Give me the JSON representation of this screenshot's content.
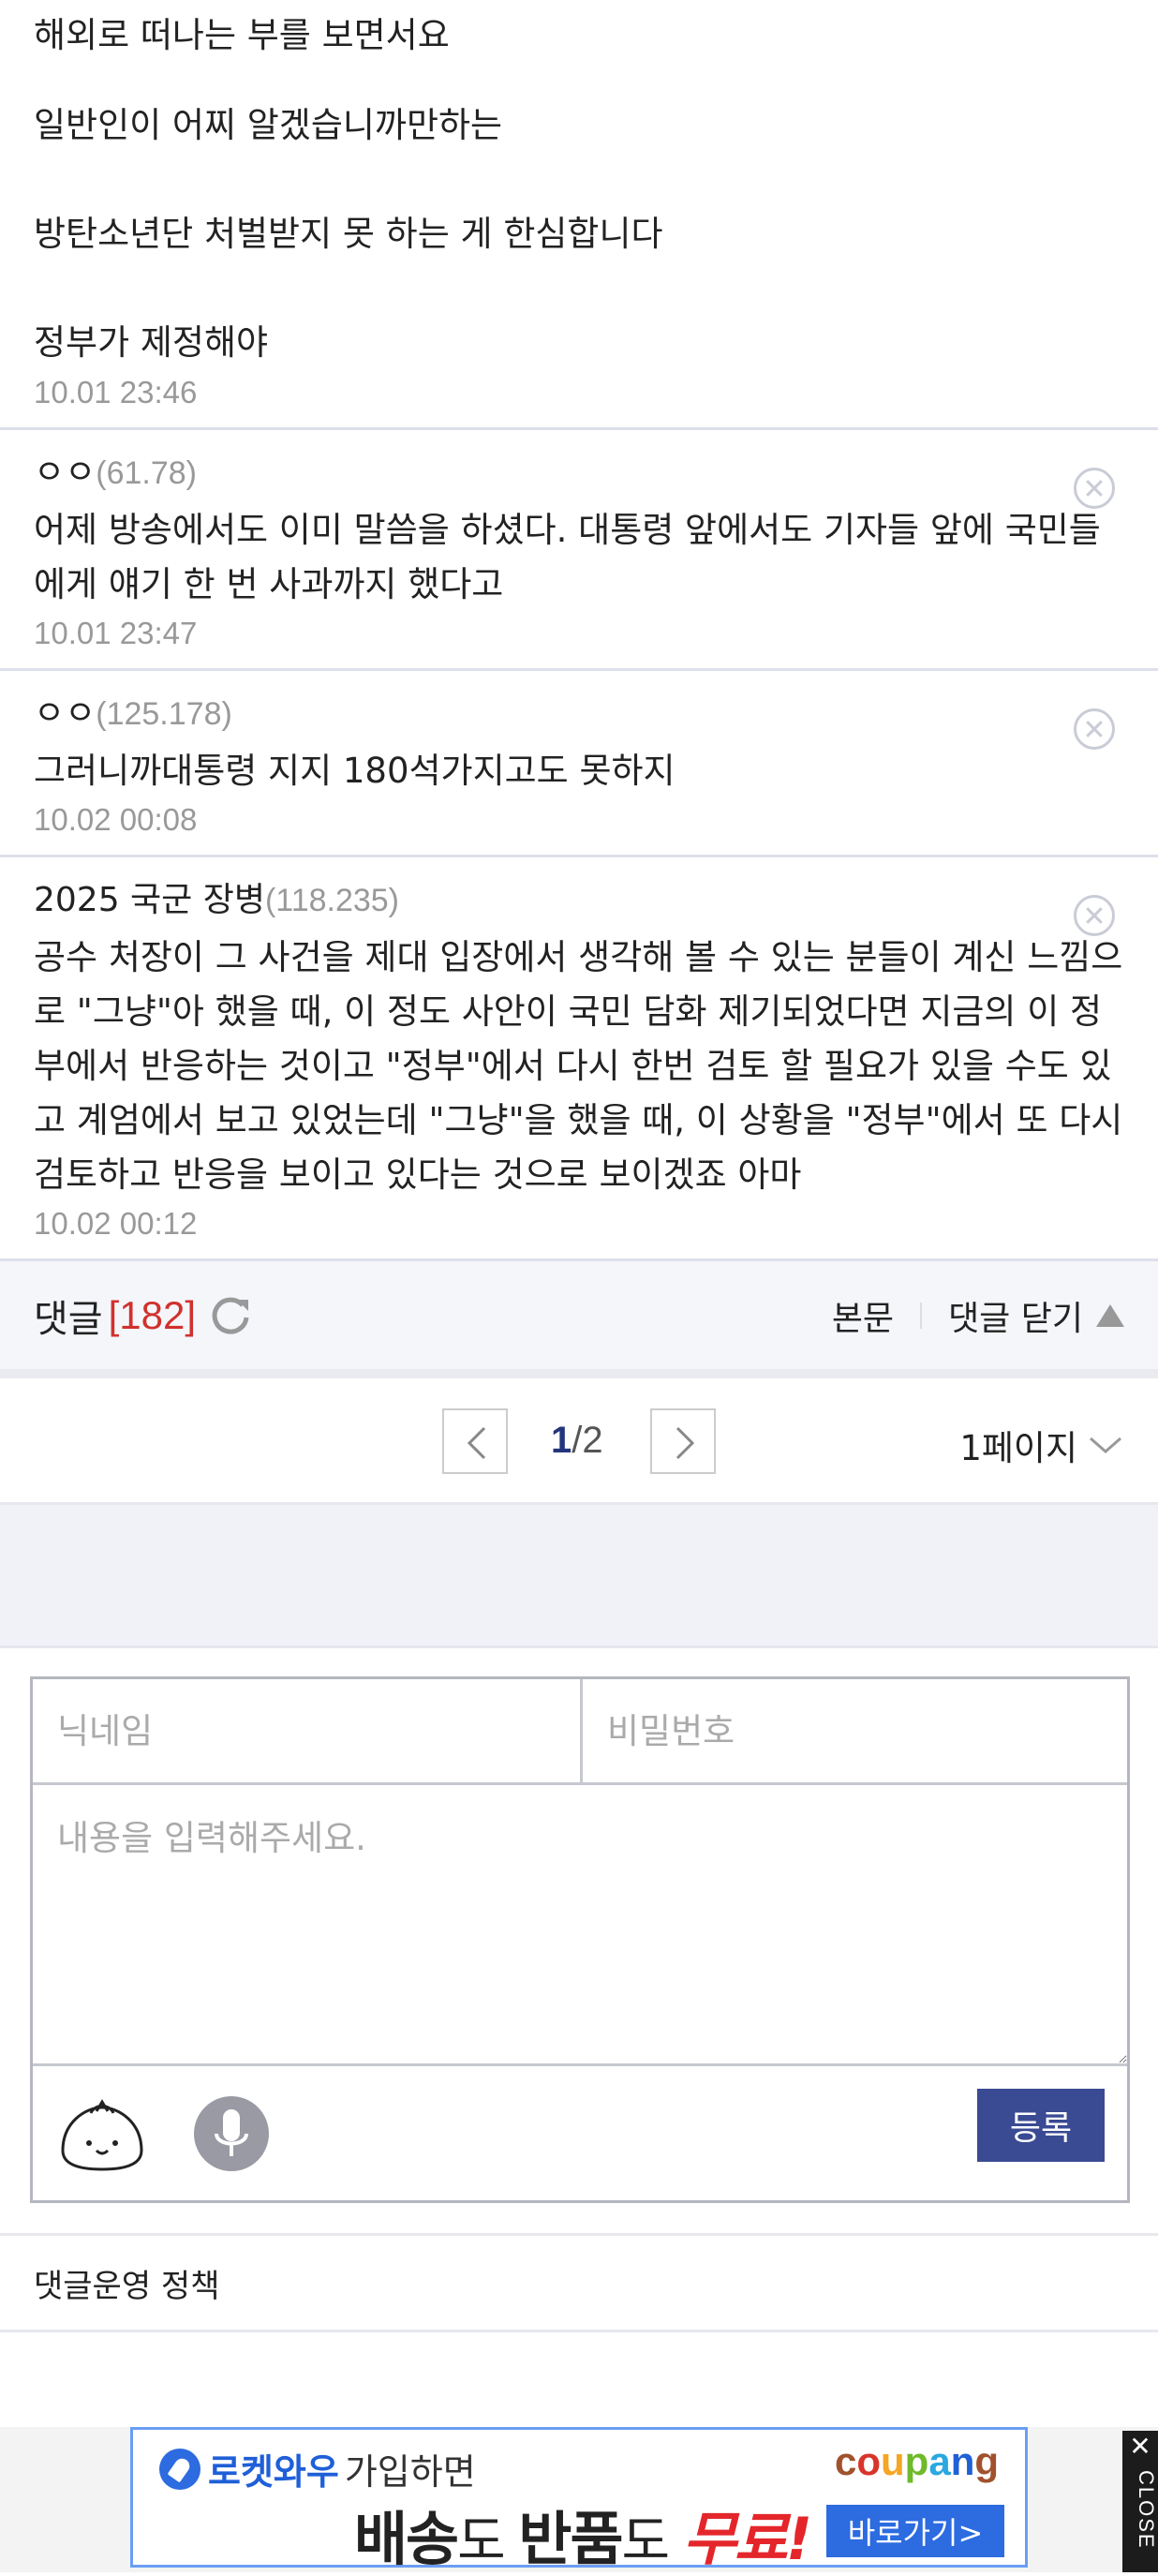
{
  "top_comment": {
    "lines": [
      "해외로 떠나는 부를 보면서요",
      "일반인이 어찌 알겠습니까만하는",
      "방탄소년단 처벌받지 못 하는 게 한심합니다",
      "정부가 제정해야"
    ],
    "date": "10.01 23:46"
  },
  "comments": [
    {
      "name": "ㅇㅇ",
      "ip": "(61.78)",
      "text": "어제 방송에서도 이미 말씀을 하셨다. 대통령 앞에서도 기자들 앞에 국민들에게 얘기 한 번 사과까지 했다고",
      "date": "10.01 23:47"
    },
    {
      "name": "ㅇㅇ",
      "ip": "(125.178)",
      "text": "그러니까대통령 지지 180석가지고도 못하지",
      "date": "10.02 00:08"
    },
    {
      "name": "2025 국군 장병",
      "ip": "(118.235)",
      "text": "공수 처장이 그 사건을 제대 입장에서 생각해 볼 수 있는 분들이 계신 느낌으로 \"그냥\"아 했을 때, 이 정도 사안이 국민 담화 제기되었다면 지금의 이 정부에서 반응하는 것이고 \"정부\"에서 다시 한번 검토 할 필요가 있을 수도 있고 계엄에서 보고 있었는데 \"그냥\"을 했을 때, 이 상황을 \"정부\"에서 또 다시 검토하고 반응을 보이고 있다는 것으로 보이겠죠 아마",
      "date": "10.02 00:12"
    }
  ],
  "comment_bar": {
    "title": "댓글",
    "count": "[182]",
    "sort_label": "본문",
    "collapse_label": "댓글 닫기"
  },
  "pager": {
    "current": "1",
    "total": "/2",
    "per_page": "1페이지"
  },
  "form": {
    "name_placeholder": "닉네임",
    "password_placeholder": "비밀번호",
    "content_placeholder": "내용을 입력해주세요.",
    "submit_label": "등록"
  },
  "rules_link": "댓글운영 정책",
  "ad": {
    "brand_line": "로켓와우",
    "brand_suffix": "가입하면",
    "logo_letters": [
      "c",
      "o",
      "u",
      "p",
      "a",
      "n",
      "g"
    ],
    "headline_1": "배송",
    "headline_2": "도 ",
    "headline_3": "반품",
    "headline_4": "도 ",
    "headline_5": "무료!",
    "cta": "바로가기>",
    "close_x": "✕",
    "close_text": "CLOSE"
  },
  "colors": {
    "accent": "#3a4a93",
    "count_red": "#d0312d",
    "page_current": "#24357d"
  }
}
